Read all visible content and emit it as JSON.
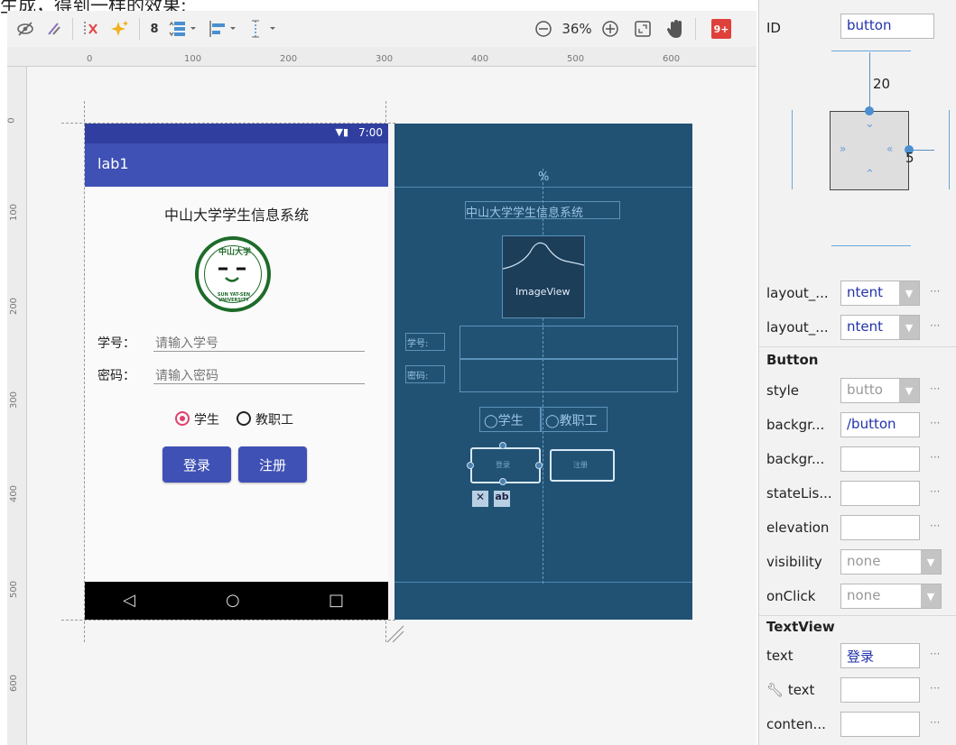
{
  "caption": "生成，得到一样的效果:",
  "toolbar": {
    "eye_icon": "eye-slash-icon",
    "magic_icon": "magnet-icon",
    "margin_value": "8",
    "zoom_level": "36%",
    "badge": "9+"
  },
  "ruler": {
    "top_labels": [
      "0",
      "100",
      "200",
      "300",
      "400",
      "500",
      "600"
    ],
    "left_labels": [
      "0",
      "100",
      "200",
      "300",
      "400",
      "500",
      "600"
    ]
  },
  "phone": {
    "status_time": "7:00",
    "app_title": "lab1",
    "system_title": "中山大学学生信息系统",
    "logo_text_top": "中山大学",
    "logo_text_bottom": "SUN YAT-SEN UNIVERSITY",
    "id_label": "学号：",
    "id_hint": "请输入学号",
    "pwd_label": "密码：",
    "pwd_hint": "请输入密码",
    "radio_student": "学生",
    "radio_staff": "教职工",
    "btn_login": "登录",
    "btn_register": "注册"
  },
  "blueprint": {
    "title": "中山大学学生信息系统",
    "imageview": "ImageView",
    "id_label": "学号:",
    "pwd_label": "密码:",
    "radio_student": "学生",
    "radio_staff": "教职工",
    "btn_login": "登录",
    "btn_register": "注册",
    "percent": "%"
  },
  "panel": {
    "id_label": "ID",
    "id_value": "button",
    "margin_top": "20",
    "margin_right": "5",
    "attrs": [
      {
        "label": "layout_...",
        "value": "ntent",
        "dropdown": true
      },
      {
        "label": "layout_...",
        "value": "ntent",
        "dropdown": true
      }
    ],
    "section_button": "Button",
    "button_attrs": [
      {
        "label": "style",
        "value": "butto",
        "dropdown": true,
        "grey": true
      },
      {
        "label": "backgr...",
        "value": "/button",
        "dropdown": false
      },
      {
        "label": "backgr...",
        "value": "",
        "dropdown": false
      },
      {
        "label": "stateLis...",
        "value": "",
        "dropdown": false
      },
      {
        "label": "elevation",
        "value": "",
        "dropdown": false
      },
      {
        "label": "visibility",
        "value": "none",
        "dropdown": true,
        "grey": true
      },
      {
        "label": "onClick",
        "value": "none",
        "dropdown": true,
        "grey": true
      }
    ],
    "section_textview": "TextView",
    "text_attrs": [
      {
        "label": "text",
        "value": "登录",
        "dropdown": false
      },
      {
        "label": "text",
        "value": "",
        "dropdown": false,
        "wrench": true
      },
      {
        "label": "conten...",
        "value": "",
        "dropdown": false
      }
    ]
  }
}
